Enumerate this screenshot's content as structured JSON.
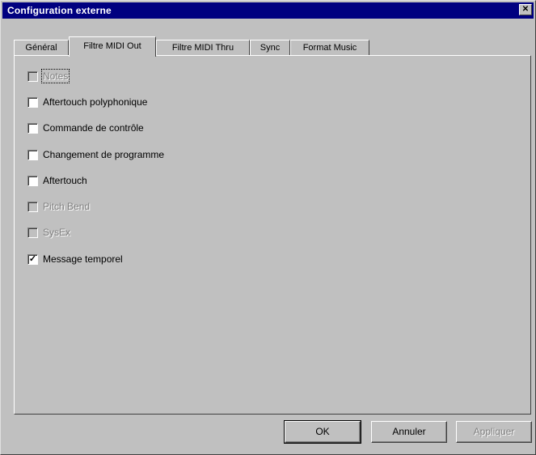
{
  "window": {
    "title": "Configuration externe"
  },
  "tabs": [
    {
      "label": "Général",
      "active": false
    },
    {
      "label": "Filtre MIDI Out",
      "active": true
    },
    {
      "label": "Filtre MIDI Thru",
      "active": false
    },
    {
      "label": "Sync",
      "active": false
    },
    {
      "label": "Format Music",
      "active": false
    }
  ],
  "filters": [
    {
      "label": "Notes",
      "checked": false,
      "enabled": false,
      "focused": true
    },
    {
      "label": "Aftertouch polyphonique",
      "checked": false,
      "enabled": true,
      "focused": false
    },
    {
      "label": "Commande de contrôle",
      "checked": false,
      "enabled": true,
      "focused": false
    },
    {
      "label": "Changement de programme",
      "checked": false,
      "enabled": true,
      "focused": false
    },
    {
      "label": "Aftertouch",
      "checked": false,
      "enabled": true,
      "focused": false
    },
    {
      "label": "Pitch Bend",
      "checked": false,
      "enabled": false,
      "focused": false
    },
    {
      "label": "SysEx",
      "checked": false,
      "enabled": false,
      "focused": false
    },
    {
      "label": "Message temporel",
      "checked": true,
      "enabled": true,
      "focused": false
    }
  ],
  "buttons": {
    "ok": "OK",
    "cancel": "Annuler",
    "apply": "Appliquer"
  },
  "icons": {
    "close": "close-icon",
    "checkmark": "checkmark-icon"
  }
}
